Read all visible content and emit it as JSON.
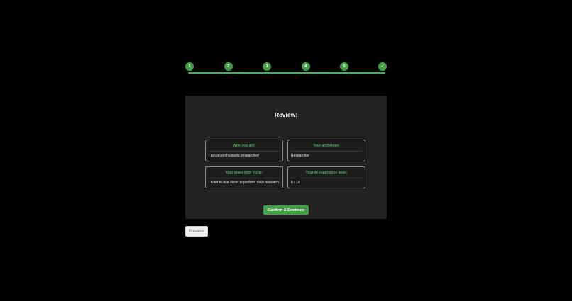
{
  "stepper": {
    "steps": [
      {
        "label": "1"
      },
      {
        "label": "2"
      },
      {
        "label": "3"
      },
      {
        "label": "4"
      },
      {
        "label": "5"
      },
      {
        "label": "✓"
      }
    ],
    "accent_color": "#43a047"
  },
  "review": {
    "title": "Review:",
    "fields": {
      "who": {
        "label": "Who you are:",
        "value": "I am an enthusiastic researcher!"
      },
      "archetype": {
        "label": "Your archetype:",
        "value": "Researcher"
      },
      "goals": {
        "label": "Your goals with Vizier:",
        "value": "I want to use Vizier to perform daily research"
      },
      "ai_level": {
        "label": "Your AI experience level:",
        "value": "8 / 10"
      }
    },
    "confirm_label": "Confirm & Continue"
  },
  "navigation": {
    "previous_label": "Previous"
  }
}
